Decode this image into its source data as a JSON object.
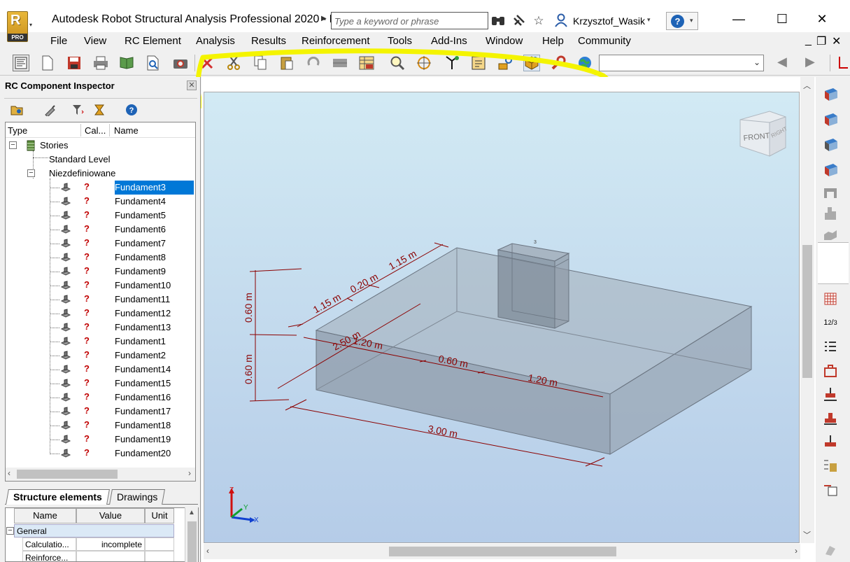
{
  "titlebar": {
    "logo_letter": "R",
    "logo_badge": "PRO",
    "title": "Autodesk Robot Structural Analysis Professional 2020 - P...",
    "search_placeholder": "Type a keyword or phrase",
    "user_name": "Krzysztof_Wasik",
    "help_label": "?"
  },
  "menu": {
    "items": [
      "File",
      "View",
      "RC Element",
      "Analysis",
      "Results",
      "Reinforcement",
      "Tools",
      "Add-Ins",
      "Window",
      "Help",
      "Community"
    ]
  },
  "panel": {
    "title": "RC Component Inspector",
    "columns": [
      "Type",
      "Cal...",
      "Name"
    ],
    "tree": {
      "root": "Stories",
      "level": "Standard Level",
      "group": "Niezdefiniowane",
      "status_mark": "?",
      "items": [
        "Fundament3",
        "Fundament4",
        "Fundament5",
        "Fundament6",
        "Fundament7",
        "Fundament8",
        "Fundament9",
        "Fundament10",
        "Fundament11",
        "Fundament12",
        "Fundament13",
        "Fundament1",
        "Fundament2",
        "Fundament14",
        "Fundament15",
        "Fundament16",
        "Fundament17",
        "Fundament18",
        "Fundament19",
        "Fundament20"
      ],
      "selected": "Fundament3"
    },
    "tabs": [
      "Structure elements",
      "Drawings"
    ],
    "properties": {
      "columns": [
        "Name",
        "Value",
        "Unit"
      ],
      "group": "General",
      "rows": [
        {
          "name": "Calculatio...",
          "value": "incomplete",
          "unit": ""
        },
        {
          "name": "Reinforce...",
          "value": "",
          "unit": ""
        }
      ]
    }
  },
  "viewport": {
    "viewcube": {
      "front": "FRONT",
      "right": "RIGHT"
    },
    "node_label": "3",
    "axes": {
      "x": "X",
      "y": "Y",
      "z": "Z"
    },
    "dimensions": {
      "top_left_115": "1.15 m",
      "top_020": "0.20 m",
      "top_right_115": "1.15 m",
      "height_upper": "0.60 m",
      "height_lower": "0.60 m",
      "depth_250": "2.50 m",
      "inner_120_left": "1.20 m",
      "inner_060": "0.60 m",
      "inner_120_right": "1.20 m",
      "length_300": "3.00 m"
    }
  },
  "colors": {
    "dimension": "#8b0000",
    "highlight": "#f4f400",
    "selection": "#0078d7",
    "footing_fill": "#8d9aa8"
  }
}
